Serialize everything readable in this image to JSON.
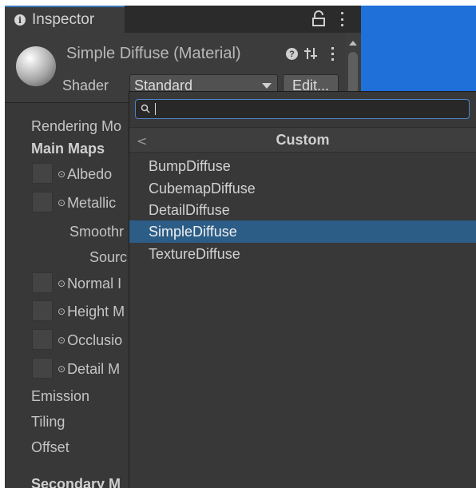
{
  "window": {
    "tab_label": "Inspector"
  },
  "header": {
    "material_title": "Simple Diffuse (Material)",
    "help_glyph": "?",
    "shader_label": "Shader",
    "shader_value": "Standard",
    "edit_label": "Edit..."
  },
  "body": {
    "rendering_mode": "Rendering Mo",
    "main_maps": "Main Maps",
    "albedo": "Albedo",
    "metallic": "Metallic",
    "smoothness": "Smoothr",
    "source": "Sourc",
    "normal_map": "Normal I",
    "height_map": "Height M",
    "occlusion": "Occlusio",
    "detail_mask": "Detail M",
    "emission": "Emission",
    "tiling": "Tiling",
    "offset": "Offset",
    "secondary_maps": "Secondary M"
  },
  "popup": {
    "search_value": "",
    "back_glyph": "<",
    "title": "Custom",
    "items": [
      {
        "label": "BumpDiffuse"
      },
      {
        "label": "CubemapDiffuse"
      },
      {
        "label": "DetailDiffuse"
      },
      {
        "label": "SimpleDiffuse"
      },
      {
        "label": "TextureDiffuse"
      }
    ],
    "selected_item": "SimpleDiffuse"
  },
  "icons": {
    "tab_icon": "info-icon",
    "lock": "lock-icon",
    "window_menu": "kebab-menu-icon",
    "material_preview": "material-sphere-icon",
    "help": "help-icon",
    "presets": "sliders-icon",
    "context_menu": "kebab-menu-icon",
    "dropdown": "caret-down-icon",
    "search": "search-icon",
    "back": "chevron-left-icon",
    "texture_picker": "target-icon"
  },
  "colors": {
    "panel_bg": "#383838",
    "header_bg": "#3c3c3c",
    "tab_accent": "#3a79bb",
    "selection": "#2c5d87",
    "search_focus": "#4d84c9",
    "scene_blue": "#1f70d8"
  }
}
